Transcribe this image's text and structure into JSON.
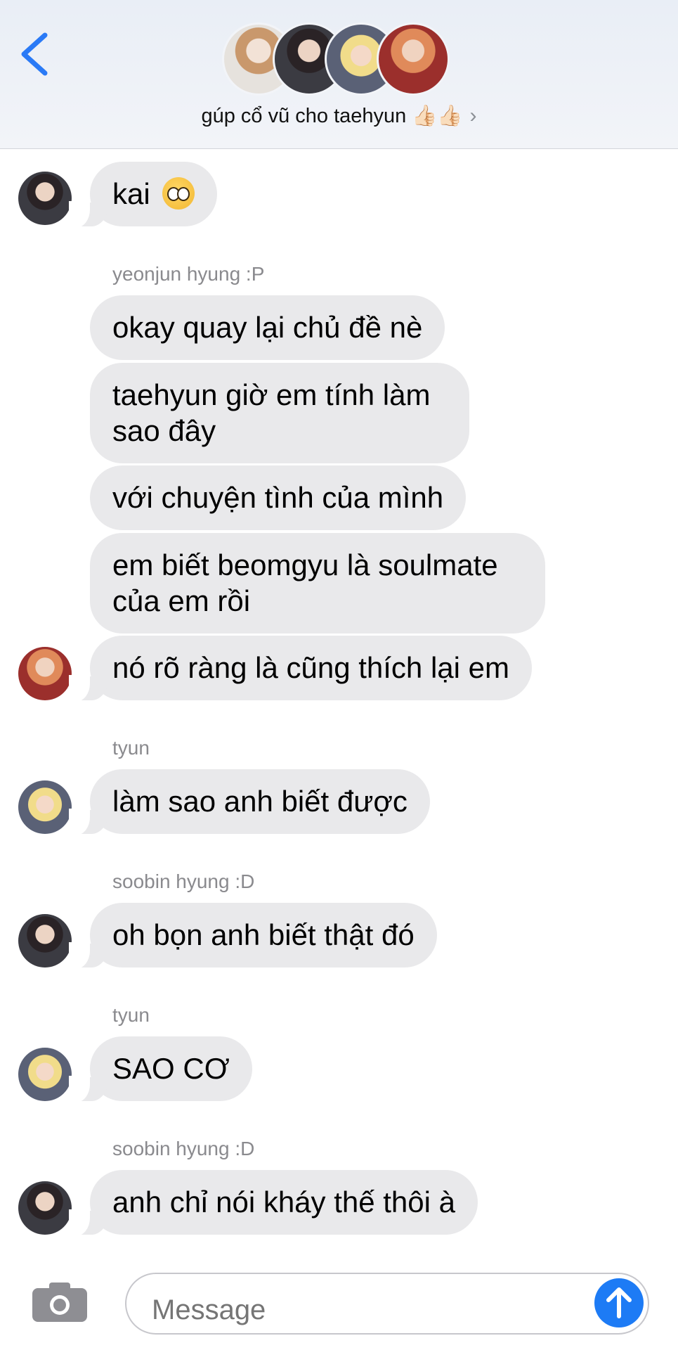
{
  "header": {
    "title": "gúp cổ vũ cho taehyun 👍🏻👍🏻",
    "back_icon": "chevron-left-icon",
    "info_icon": "chevron-right-icon"
  },
  "messages": [
    {
      "text": "kai",
      "emoji": "pleading-face-emoji"
    },
    {
      "sender": "yeonjun hyung :P"
    },
    {
      "text": "okay quay lại chủ đề nè"
    },
    {
      "text": "taehyun giờ em tính làm sao đây"
    },
    {
      "text": "với chuyện tình của mình"
    },
    {
      "text": "em biết beomgyu là soulmate của em rồi"
    },
    {
      "text": "nó rõ ràng là cũng thích lại em"
    },
    {
      "sender": "tyun"
    },
    {
      "text": "làm sao anh biết được"
    },
    {
      "sender": "soobin hyung :D"
    },
    {
      "text": "oh bọn anh biết thật đó"
    },
    {
      "sender": "tyun"
    },
    {
      "text": "SAO CƠ"
    },
    {
      "sender": "soobin hyung :D"
    },
    {
      "text": "anh chỉ nói kháy thế thôi à"
    }
  ],
  "composer": {
    "placeholder": "Message",
    "camera_icon": "camera-icon",
    "send_icon": "send-arrow-icon"
  },
  "colors": {
    "accent": "#1d7bf5",
    "bubble": "#e9e9eb"
  }
}
